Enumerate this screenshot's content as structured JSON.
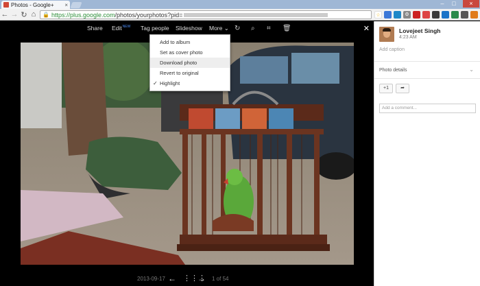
{
  "browser": {
    "tab_title": "Photos - Google+",
    "tab_close": "×",
    "url_host": "https://plus.google.com",
    "url_path": "/photos/yourphotos?pid=",
    "window_controls": [
      "–",
      "□",
      "×"
    ]
  },
  "toolbar": {
    "share": "Share",
    "edit": "Edit",
    "edit_badge": "NEW",
    "tag_people": "Tag people",
    "slideshow": "Slideshow",
    "more": "More",
    "more_caret": "⌄",
    "close": "✕"
  },
  "more_menu": {
    "items": [
      {
        "label": "Add to album",
        "checked": false,
        "hovered": false
      },
      {
        "label": "Set as cover photo",
        "checked": false,
        "hovered": false
      },
      {
        "label": "Download photo",
        "checked": false,
        "hovered": true
      },
      {
        "label": "Revert to original",
        "checked": false,
        "hovered": false
      },
      {
        "label": "Highlight",
        "checked": true,
        "hovered": false
      }
    ],
    "check_glyph": "✓"
  },
  "footer": {
    "date": "2013-09-17",
    "counter": "1 of 54"
  },
  "panel": {
    "user_name": "Lovejeet Singh",
    "time": "4:23 AM",
    "add_caption": "Add caption",
    "photo_details": "Photo details",
    "plus_one": "+1",
    "share_arrow": "➦",
    "comment_placeholder": "Add a comment..."
  }
}
